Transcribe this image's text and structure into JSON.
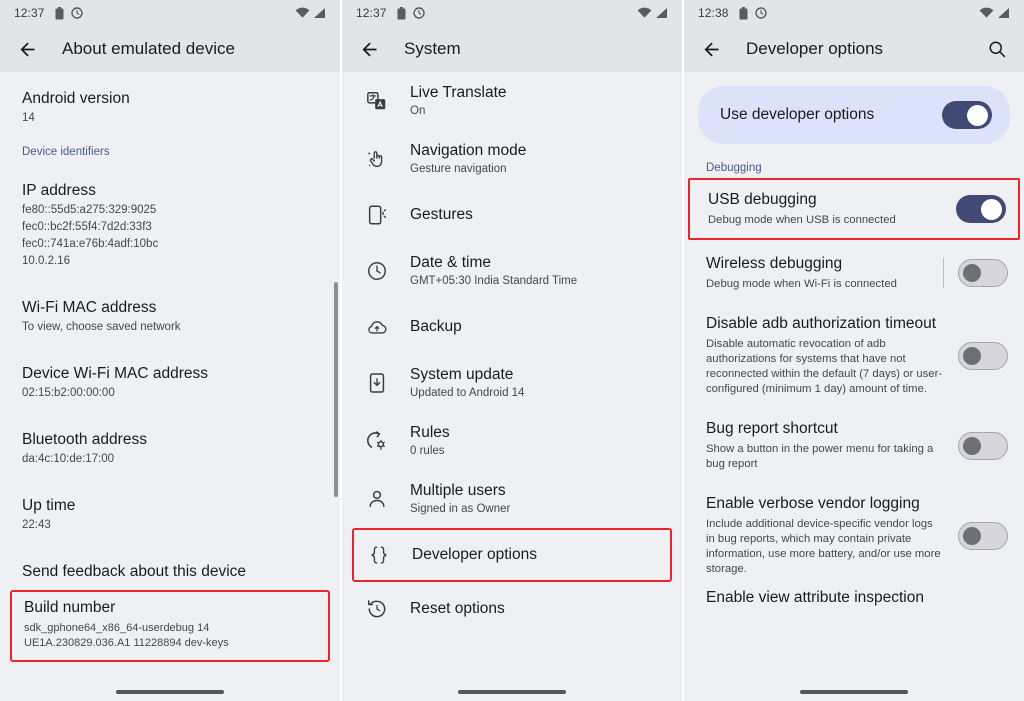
{
  "panels": [
    {
      "status": {
        "time": "12:37",
        "icons": [
          "battery-icon",
          "clock-icon",
          "wifi-icon",
          "signal-icon"
        ]
      },
      "appbar": {
        "title": "About emulated device",
        "back_icon": "back-arrow-icon"
      },
      "items": [
        {
          "title": "Android version",
          "sub": "14"
        }
      ],
      "section_label": "Device identifiers",
      "details": [
        {
          "title": "IP address",
          "lines": [
            "fe80::55d5:a275:329:9025",
            "fec0::bc2f:55f4:7d2d:33f3",
            "fec0::741a:e76b:4adf:10bc",
            "10.0.2.16"
          ]
        },
        {
          "title": "Wi-Fi MAC address",
          "lines": [
            "To view, choose saved network"
          ]
        },
        {
          "title": "Device Wi-Fi MAC address",
          "lines": [
            "02:15:b2:00:00:00"
          ]
        },
        {
          "title": "Bluetooth address",
          "lines": [
            "da:4c:10:de:17:00"
          ]
        },
        {
          "title": "Up time",
          "lines": [
            "22:43"
          ]
        },
        {
          "title": "Send feedback about this device",
          "lines": []
        }
      ],
      "highlight": {
        "title": "Build number",
        "lines": [
          "sdk_gphone64_x86_64-userdebug 14",
          "UE1A.230829.036.A1 11228894 dev-keys"
        ]
      }
    },
    {
      "status": {
        "time": "12:37"
      },
      "appbar": {
        "title": "System",
        "back_icon": "back-arrow-icon"
      },
      "rows": [
        {
          "icon": "live-translate-icon",
          "label": "Live Translate",
          "sub": "On",
          "boxed": false
        },
        {
          "icon": "navigation-mode-icon",
          "label": "Navigation mode",
          "sub": "Gesture navigation",
          "boxed": false
        },
        {
          "icon": "gestures-icon",
          "label": "Gestures",
          "sub": "",
          "boxed": false
        },
        {
          "icon": "clock-icon",
          "label": "Date & time",
          "sub": "GMT+05:30 India Standard Time",
          "boxed": false
        },
        {
          "icon": "backup-cloud-icon",
          "label": "Backup",
          "sub": "",
          "boxed": false
        },
        {
          "icon": "system-update-icon",
          "label": "System update",
          "sub": "Updated to Android 14",
          "boxed": false
        },
        {
          "icon": "rules-icon",
          "label": "Rules",
          "sub": "0 rules",
          "boxed": false
        },
        {
          "icon": "multiple-users-icon",
          "label": "Multiple users",
          "sub": "Signed in as Owner",
          "boxed": false
        },
        {
          "icon": "developer-options-icon",
          "label": "Developer options",
          "sub": "",
          "boxed": true
        },
        {
          "icon": "reset-options-icon",
          "label": "Reset options",
          "sub": "",
          "boxed": false
        }
      ]
    },
    {
      "status": {
        "time": "12:38"
      },
      "appbar": {
        "title": "Developer options",
        "back_icon": "back-arrow-icon",
        "search_icon": "search-icon"
      },
      "master": {
        "label": "Use developer options",
        "state": "on"
      },
      "section_label": "Debugging",
      "rows": [
        {
          "label": "USB debugging",
          "sub": "Debug mode when USB is connected",
          "state": "on",
          "boxed": true,
          "divider": false
        },
        {
          "label": "Wireless debugging",
          "sub": "Debug mode when Wi-Fi is connected",
          "state": "off",
          "boxed": false,
          "divider": true
        },
        {
          "label": "Disable adb authorization timeout",
          "sub": "Disable automatic revocation of adb authorizations for systems that have not reconnected within the default (7 days) or user-configured (minimum 1 day) amount of time.",
          "state": "off",
          "boxed": false,
          "divider": false
        },
        {
          "label": "Bug report shortcut",
          "sub": "Show a button in the power menu for taking a bug report",
          "state": "off",
          "boxed": false,
          "divider": false
        },
        {
          "label": "Enable verbose vendor logging",
          "sub": "Include additional device-specific vendor logs in bug reports, which may contain private information, use more battery, and/or use more storage.",
          "state": "off",
          "boxed": false,
          "divider": false
        }
      ],
      "cut_row": {
        "label": "Enable view attribute inspection"
      }
    }
  ],
  "colors": {
    "accent_red": "#e8252a",
    "toggle_on": "#414a72",
    "chip_bg": "#dbe2f9",
    "section_text": "#4b5a8a",
    "surface": "#eff0f4",
    "appbar": "#e3e4e8"
  }
}
